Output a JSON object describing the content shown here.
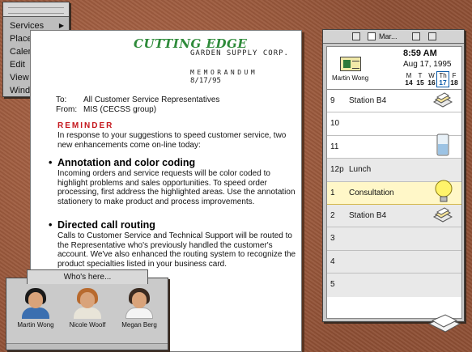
{
  "menu": {
    "items": [
      {
        "label": "Services"
      },
      {
        "label": "Place"
      },
      {
        "label": "Calendar"
      },
      {
        "label": "Edit"
      },
      {
        "label": "View"
      },
      {
        "label": "Window"
      }
    ]
  },
  "memo": {
    "logo": "CUTTING EDGE",
    "subtitle": "GARDEN SUPPLY CORP.",
    "doc_type": "MEMORANDUM",
    "date": "8/17/95",
    "to_label": "To:",
    "to_value": "All Customer Service Representatives",
    "from_label": "From:",
    "from_value": "MIS (CECSS group)",
    "reminder": "REMINDER",
    "intro": "In response to your suggestions to speed customer service, two new enhancements come on-line today:",
    "bullets": [
      {
        "title": "Annotation and color coding",
        "body": "Incoming orders and service requests will be color coded to highlight problems and sales opportunities. To speed order processing, first address the highlighted areas. Use the annotation stationery to make product and process improvements."
      },
      {
        "title": "Directed call routing",
        "body": "Calls to Customer Service and Technical Support will be routed to the Representative who's previously handled the customer's account. We've also enhanced the routing system to recognize the product specialties listed in your business card."
      }
    ]
  },
  "calendar": {
    "title": "Mar...",
    "owner": "Martin Wong",
    "time": "8:59 AM",
    "date": "Aug 17, 1995",
    "week": [
      {
        "d": "M",
        "n": "14"
      },
      {
        "d": "T",
        "n": "15"
      },
      {
        "d": "W",
        "n": "16"
      },
      {
        "d": "Th",
        "n": "17"
      },
      {
        "d": "F",
        "n": "18"
      }
    ],
    "today_index": 3,
    "slots": [
      {
        "hour": "9",
        "event": "Station B4"
      },
      {
        "hour": "10",
        "event": ""
      },
      {
        "hour": "11",
        "event": ""
      },
      {
        "hour": "12p",
        "event": "Lunch"
      },
      {
        "hour": "1",
        "event": "Consultation"
      },
      {
        "hour": "2",
        "event": "Station B4"
      },
      {
        "hour": "3",
        "event": ""
      },
      {
        "hour": "4",
        "event": ""
      },
      {
        "hour": "5",
        "event": ""
      }
    ],
    "highlight_index": 4
  },
  "whos_here": {
    "title": "Who's here...",
    "people": [
      {
        "name": "Martin Wong",
        "hair": "#1a1a1a",
        "shirt": "#3b6fb0"
      },
      {
        "name": "Nicole Woolf",
        "hair": "#b86a2e",
        "shirt": "#e8e4d8"
      },
      {
        "name": "Megan Berg",
        "hair": "#3a2a20",
        "shirt": "#f4f4f4"
      }
    ]
  },
  "colors": {
    "desk": "#9a5a3c",
    "logo_green": "#2e8b3a",
    "reminder_red": "#c4161c",
    "highlight": "#fff7c8"
  }
}
